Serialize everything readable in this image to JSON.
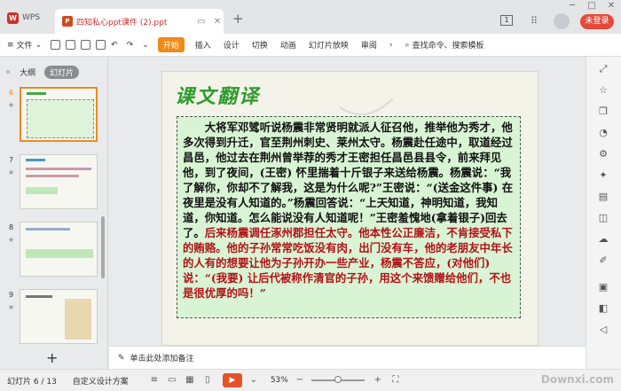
{
  "titlebar": {
    "app_name": "WPS",
    "doc_title": "四知私心ppt课件 (2).ppt",
    "login_label": "未登录",
    "doc_count": "1"
  },
  "toolbar": {
    "file_label": "文件",
    "start_label": "开始",
    "menus": [
      "插入",
      "设计",
      "切换",
      "动画",
      "幻灯片放映",
      "审阅"
    ],
    "search_label": "查找命令、搜索模板"
  },
  "leftpanel": {
    "tab_outline": "大纲",
    "tab_slides": "幻灯片",
    "slides": [
      {
        "num": "6"
      },
      {
        "num": "7"
      },
      {
        "num": "8"
      },
      {
        "num": "9"
      }
    ]
  },
  "slide": {
    "title": "课文翻译",
    "text_black": "大将军邓骘听说杨震非常贤明就派人征召他，推举他为秀才，他多次得到升迁，官至荆州刺史、莱州太守。杨震赴任途中，取道经过昌邑，他过去在荆州曾举荐的秀才王密担任昌邑县县令，前来拜见他，到了夜间，(王密) 怀里揣着十斤银子来送给杨震。杨震说：“我了解你，你却不了解我，这是为什么呢?”王密说：“(送金这件事) 在夜里是没有人知道的。”杨震回答说：“上天知道，神明知道，我知道，你知道。怎么能说没有人知道呢！”王密羞愧地(拿着银子)回去了。",
    "text_red": "后来杨震调任涿州郡担任太守。他本性公正廉洁，不肯接受私下的贿赂。他的子孙常常吃饭没有肉，出门没有车，他的老朋友中年长的人有的想要让他为子孙开办一些产业，杨震不答应，(对他们) 说：“(我要) 让后代被称作清官的子孙，用这个来馈赠给他们，不也是很优厚的吗！”"
  },
  "notes": {
    "placeholder": "单击此处添加备注"
  },
  "statusbar": {
    "slide_info": "幻灯片 6 / 13",
    "theme": "自定义设计方案",
    "zoom": "53%"
  },
  "watermark": "Downxi.com",
  "colors": {
    "accent": "#f08a1a",
    "login": "#e5493a",
    "title_green": "#2e9b2e",
    "text_red": "#b31217",
    "textbox_bg": "#d8f4d4"
  }
}
